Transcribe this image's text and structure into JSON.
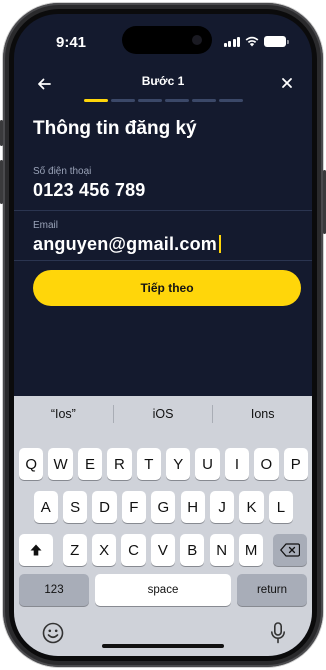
{
  "status_bar": {
    "time": "9:41"
  },
  "nav": {
    "back_icon": "arrow-left-icon",
    "title": "Bước 1",
    "close_icon": "close-icon"
  },
  "progress": {
    "total_steps": 6,
    "current_step": 1
  },
  "page_title": "Thông tin đăng ký",
  "phone_field": {
    "label": "Số điện thoại",
    "value": "0123 456 789"
  },
  "email_field": {
    "label": "Email",
    "value": "anguyen@gmail.com"
  },
  "cta": {
    "label": "Tiếp theo",
    "color": "#ffd60a"
  },
  "keyboard": {
    "suggestions": [
      "“Ios”",
      "iOS",
      "Ions"
    ],
    "row1": [
      "Q",
      "W",
      "E",
      "R",
      "T",
      "Y",
      "U",
      "I",
      "O",
      "P"
    ],
    "row2": [
      "A",
      "S",
      "D",
      "F",
      "G",
      "H",
      "J",
      "K",
      "L"
    ],
    "row3": [
      "Z",
      "X",
      "C",
      "V",
      "B",
      "N",
      "M"
    ],
    "numbers_label": "123",
    "space_label": "space",
    "return_label": "return",
    "shift_icon": "shift-icon",
    "delete_icon": "backspace-icon",
    "emoji_icon": "emoji-icon",
    "mic_icon": "microphone-icon"
  },
  "colors": {
    "background": "#141a2e",
    "accent": "#ffd60a",
    "keyboard_bg": "#cfd2d9"
  }
}
